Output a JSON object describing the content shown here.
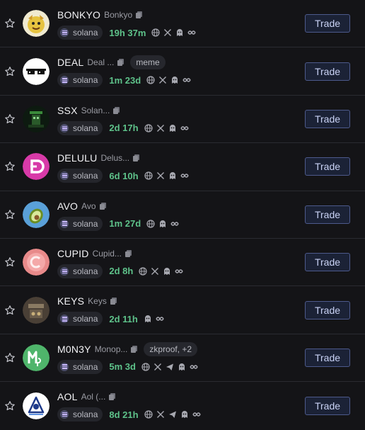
{
  "colors": {
    "background": "#141417",
    "row_divider": "#2a2b31",
    "age_green": "#5ec28a",
    "trade_border": "#4d5a8c",
    "trade_text": "#c9d2f5"
  },
  "rows": [
    {
      "symbol": "BONKYO",
      "name": "Bonkyo",
      "tag": "",
      "chain": "solana",
      "age": "19h 37m",
      "socials": [
        "globe-icon",
        "x-icon",
        "ghost-icon",
        "link-icon"
      ],
      "trade_label": "Trade"
    },
    {
      "symbol": "DEAL",
      "name": "Deal ...",
      "tag": "meme",
      "chain": "solana",
      "age": "1m 23d",
      "socials": [
        "globe-icon",
        "x-icon",
        "ghost-icon",
        "link-icon"
      ],
      "trade_label": "Trade"
    },
    {
      "symbol": "SSX",
      "name": "Solan...",
      "tag": "",
      "chain": "solana",
      "age": "2d 17h",
      "socials": [
        "globe-icon",
        "x-icon",
        "ghost-icon",
        "link-icon"
      ],
      "trade_label": "Trade"
    },
    {
      "symbol": "DELULU",
      "name": "Delus...",
      "tag": "",
      "chain": "solana",
      "age": "6d 10h",
      "socials": [
        "globe-icon",
        "x-icon",
        "ghost-icon",
        "link-icon"
      ],
      "trade_label": "Trade"
    },
    {
      "symbol": "AVO",
      "name": "Avo",
      "tag": "",
      "chain": "solana",
      "age": "1m 27d",
      "socials": [
        "globe-icon",
        "ghost-icon",
        "link-icon"
      ],
      "trade_label": "Trade"
    },
    {
      "symbol": "CUPID",
      "name": "Cupid...",
      "tag": "",
      "chain": "solana",
      "age": "2d 8h",
      "socials": [
        "globe-icon",
        "x-icon",
        "ghost-icon",
        "link-icon"
      ],
      "trade_label": "Trade"
    },
    {
      "symbol": "KEYS",
      "name": "Keys",
      "tag": "",
      "chain": "solana",
      "age": "2d 11h",
      "socials": [
        "ghost-icon",
        "link-icon"
      ],
      "trade_label": "Trade"
    },
    {
      "symbol": "M0N3Y",
      "name": "Monop...",
      "tag": "zkproof, +2",
      "chain": "solana",
      "age": "5m 3d",
      "socials": [
        "globe-icon",
        "x-icon",
        "telegram-icon",
        "ghost-icon",
        "link-icon"
      ],
      "trade_label": "Trade"
    },
    {
      "symbol": "AOL",
      "name": "Aol (...",
      "tag": "",
      "chain": "solana",
      "age": "8d 21h",
      "socials": [
        "globe-icon",
        "x-icon",
        "telegram-icon",
        "ghost-icon",
        "link-icon"
      ],
      "trade_label": "Trade"
    }
  ]
}
